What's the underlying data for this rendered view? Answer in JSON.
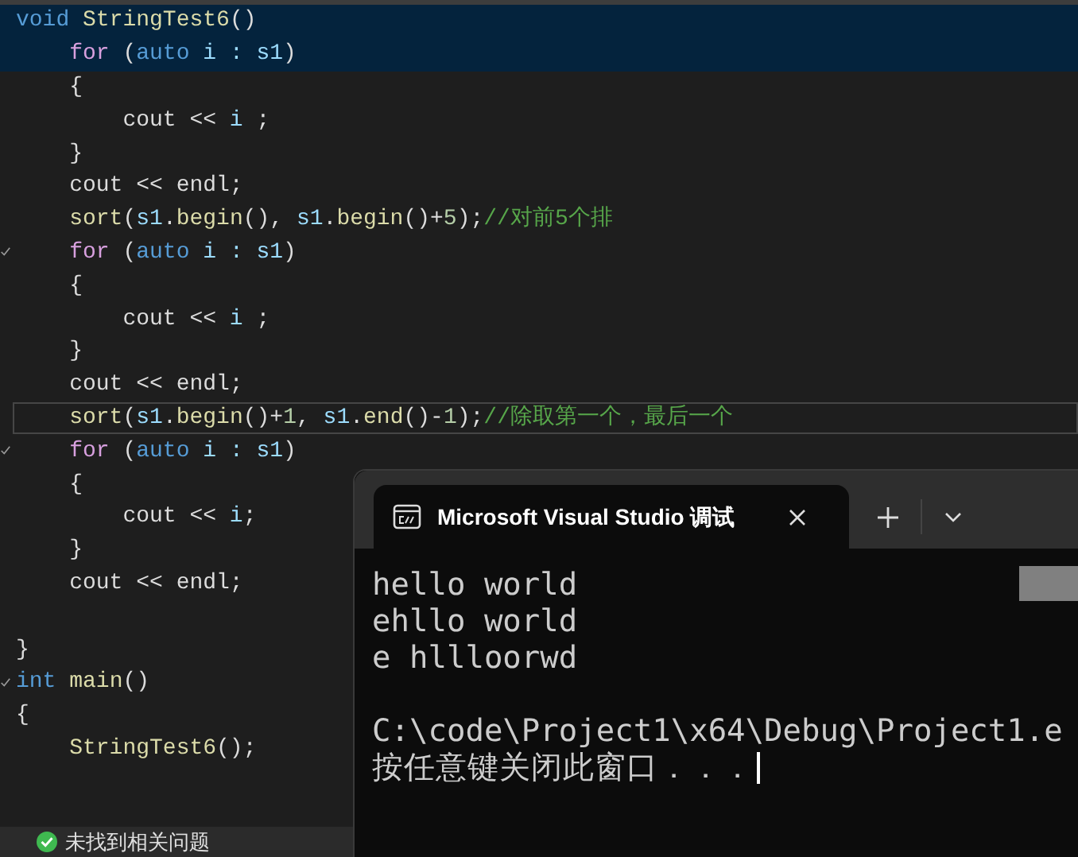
{
  "editor": {
    "lines": [
      {
        "highlighted": true,
        "current": false,
        "check": false,
        "tokens": [
          {
            "text": "void ",
            "kind": "keyword"
          },
          {
            "text": "StringTest6",
            "kind": "func"
          },
          {
            "text": "()",
            "kind": "plain"
          }
        ]
      },
      {
        "highlighted": true,
        "current": false,
        "check": false,
        "tokens": [
          {
            "text": "    for",
            "kind": "control"
          },
          {
            "text": " (",
            "kind": "plain"
          },
          {
            "text": "auto",
            "kind": "keyword"
          },
          {
            "text": " i : s1",
            "kind": "var"
          },
          {
            "text": ")",
            "kind": "plain"
          }
        ]
      },
      {
        "highlighted": false,
        "current": false,
        "check": false,
        "tokens": [
          {
            "text": "    {",
            "kind": "plain"
          }
        ]
      },
      {
        "highlighted": false,
        "current": false,
        "check": false,
        "tokens": [
          {
            "text": "        cout << ",
            "kind": "plain"
          },
          {
            "text": "i",
            "kind": "var"
          },
          {
            "text": " ;",
            "kind": "plain"
          }
        ]
      },
      {
        "highlighted": false,
        "current": false,
        "check": false,
        "tokens": [
          {
            "text": "    }",
            "kind": "plain"
          }
        ]
      },
      {
        "highlighted": false,
        "current": false,
        "check": false,
        "tokens": [
          {
            "text": "    cout << endl;",
            "kind": "plain"
          }
        ]
      },
      {
        "highlighted": false,
        "current": false,
        "check": false,
        "tokens": [
          {
            "text": "    sort",
            "kind": "func"
          },
          {
            "text": "(",
            "kind": "plain"
          },
          {
            "text": "s1",
            "kind": "var"
          },
          {
            "text": ".",
            "kind": "plain"
          },
          {
            "text": "begin",
            "kind": "func"
          },
          {
            "text": "(), ",
            "kind": "plain"
          },
          {
            "text": "s1",
            "kind": "var"
          },
          {
            "text": ".",
            "kind": "plain"
          },
          {
            "text": "begin",
            "kind": "func"
          },
          {
            "text": "()+",
            "kind": "plain"
          },
          {
            "text": "5",
            "kind": "number"
          },
          {
            "text": ");",
            "kind": "plain"
          },
          {
            "text": "//对前5个排",
            "kind": "comment"
          }
        ]
      },
      {
        "highlighted": false,
        "current": false,
        "check": true,
        "tokens": [
          {
            "text": "    for",
            "kind": "control"
          },
          {
            "text": " (",
            "kind": "plain"
          },
          {
            "text": "auto",
            "kind": "keyword"
          },
          {
            "text": " i : s1",
            "kind": "var"
          },
          {
            "text": ")",
            "kind": "plain"
          }
        ]
      },
      {
        "highlighted": false,
        "current": false,
        "check": false,
        "tokens": [
          {
            "text": "    {",
            "kind": "plain"
          }
        ]
      },
      {
        "highlighted": false,
        "current": false,
        "check": false,
        "tokens": [
          {
            "text": "        cout << ",
            "kind": "plain"
          },
          {
            "text": "i",
            "kind": "var"
          },
          {
            "text": " ;",
            "kind": "plain"
          }
        ]
      },
      {
        "highlighted": false,
        "current": false,
        "check": false,
        "tokens": [
          {
            "text": "    }",
            "kind": "plain"
          }
        ]
      },
      {
        "highlighted": false,
        "current": false,
        "check": false,
        "tokens": [
          {
            "text": "    cout << endl;",
            "kind": "plain"
          }
        ]
      },
      {
        "highlighted": false,
        "current": true,
        "check": false,
        "tokens": [
          {
            "text": "    sort",
            "kind": "func"
          },
          {
            "text": "(",
            "kind": "plain"
          },
          {
            "text": "s1",
            "kind": "var"
          },
          {
            "text": ".",
            "kind": "plain"
          },
          {
            "text": "begin",
            "kind": "func"
          },
          {
            "text": "()+",
            "kind": "plain"
          },
          {
            "text": "1",
            "kind": "number"
          },
          {
            "text": ", ",
            "kind": "plain"
          },
          {
            "text": "s1",
            "kind": "var"
          },
          {
            "text": ".",
            "kind": "plain"
          },
          {
            "text": "end",
            "kind": "func"
          },
          {
            "text": "()-",
            "kind": "plain"
          },
          {
            "text": "1",
            "kind": "number"
          },
          {
            "text": ");",
            "kind": "plain"
          },
          {
            "text": "//除取第一个，最后一个",
            "kind": "comment"
          }
        ]
      },
      {
        "highlighted": false,
        "current": false,
        "check": true,
        "tokens": [
          {
            "text": "    for",
            "kind": "control"
          },
          {
            "text": " (",
            "kind": "plain"
          },
          {
            "text": "auto",
            "kind": "keyword"
          },
          {
            "text": " i : s1",
            "kind": "var"
          },
          {
            "text": ")",
            "kind": "plain"
          }
        ]
      },
      {
        "highlighted": false,
        "current": false,
        "check": false,
        "tokens": [
          {
            "text": "    {",
            "kind": "plain"
          }
        ]
      },
      {
        "highlighted": false,
        "current": false,
        "check": false,
        "tokens": [
          {
            "text": "        cout << ",
            "kind": "plain"
          },
          {
            "text": "i",
            "kind": "var"
          },
          {
            "text": ";",
            "kind": "plain"
          }
        ]
      },
      {
        "highlighted": false,
        "current": false,
        "check": false,
        "tokens": [
          {
            "text": "    }",
            "kind": "plain"
          }
        ]
      },
      {
        "highlighted": false,
        "current": false,
        "check": false,
        "tokens": [
          {
            "text": "    cout << endl;",
            "kind": "plain"
          }
        ]
      },
      {
        "highlighted": false,
        "current": false,
        "check": false
      },
      {
        "highlighted": false,
        "current": false,
        "check": false,
        "tokens": [
          {
            "text": "}",
            "kind": "plain"
          }
        ]
      },
      {
        "highlighted": false,
        "current": false,
        "check": true,
        "tokens": [
          {
            "text": "int ",
            "kind": "keyword"
          },
          {
            "text": "main",
            "kind": "func"
          },
          {
            "text": "()",
            "kind": "plain"
          }
        ]
      },
      {
        "highlighted": false,
        "current": false,
        "check": false,
        "tokens": [
          {
            "text": "{",
            "kind": "plain"
          }
        ]
      },
      {
        "highlighted": false,
        "current": false,
        "check": false,
        "tokens": [
          {
            "text": "    StringTest6",
            "kind": "func"
          },
          {
            "text": "();",
            "kind": "plain"
          }
        ]
      }
    ]
  },
  "status_bar": {
    "message": "未找到相关问题"
  },
  "terminal": {
    "tab": {
      "title": "Microsoft Visual Studio 调试"
    },
    "output": [
      "hello world",
      "ehllo world",
      "e hllloorwd"
    ],
    "prompt": [
      "C:\\code\\Project1\\x64\\Debug\\Project1.e",
      "按任意键关闭此窗口．．．"
    ]
  }
}
